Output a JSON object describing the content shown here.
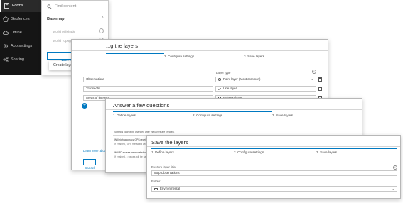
{
  "sidebar": {
    "items": [
      {
        "label": "Forms",
        "icon": "forms-icon"
      },
      {
        "label": "Geofences",
        "icon": "geofence-icon"
      },
      {
        "label": "Offline",
        "icon": "cloud-icon"
      },
      {
        "label": "App settings",
        "icon": "gear-icon"
      },
      {
        "label": "Sharing",
        "icon": "share-icon"
      }
    ]
  },
  "content_panel": {
    "search_placeholder": "Find content",
    "section": "Basemap",
    "basemaps": [
      "World Hillshade",
      "World Topographic Map"
    ],
    "add_layers": "Add layers",
    "menu_item": "Create layers"
  },
  "dialog1": {
    "title": "...g the layers",
    "steps": [
      "2.  Configure settings",
      "3.  Save layers"
    ],
    "layer_type_header": "Layer type",
    "rows": [
      {
        "name": "Observations",
        "type": "Point layer (Most common)"
      },
      {
        "name": "Transects",
        "type": "Line layer"
      },
      {
        "name": "Areas of interest",
        "type": "Polygon layer"
      }
    ],
    "learn_more": "Learn more about",
    "cancel": "Cancel"
  },
  "dialog2": {
    "title": "Answer a few questions",
    "steps": [
      "1.  Define layers",
      "2.  Configure settings",
      "3.  Save layers"
    ],
    "note": "Settings cannot be changed after the layers are created.",
    "q1": "Will high-accuracy GPS receiv...",
    "q1_help": "If enabled, GPS metadata will be...",
    "q2": "Will 3D spaces be modeled w...",
    "q2_help": "If enabled, z-values will be cap..."
  },
  "dialog3": {
    "title": "Save the layers",
    "steps": [
      "1.  Define layers",
      "2.  Configure settings",
      "3.  Save layers"
    ],
    "feature_label": "Feature layer title",
    "feature_value": "Map Observations",
    "folder_label": "Folder",
    "folder_value": "Environmental"
  },
  "colors": {
    "sidebar": "#151515",
    "accent": "#0079c1"
  }
}
